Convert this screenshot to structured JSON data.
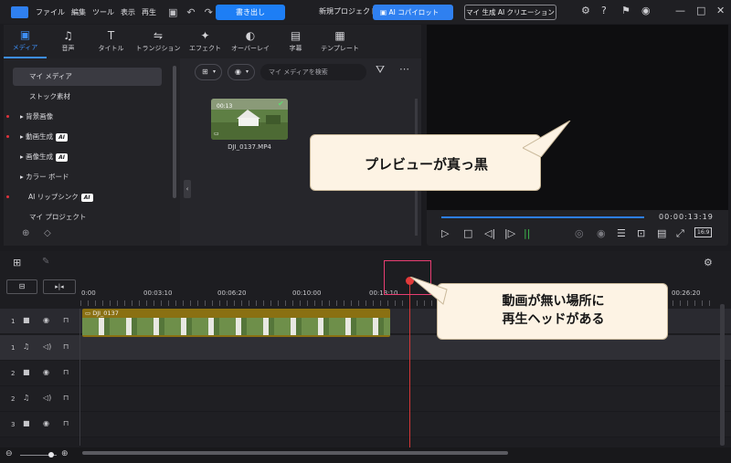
{
  "menu": [
    "ファイル",
    "編集",
    "ツール",
    "表示",
    "再生"
  ],
  "toolbar": {
    "export_label": "書き出し",
    "project_title": "新規プロジェクト (",
    "copilot_label": "AI コパイロット",
    "ai_creation_label": "マイ 生成 AI クリエーション"
  },
  "tabs": [
    {
      "label": "メディア",
      "icon": "media-icon",
      "glyph": "▣"
    },
    {
      "label": "音声",
      "icon": "music-note-icon",
      "glyph": "♫"
    },
    {
      "label": "タイトル",
      "icon": "text-icon",
      "glyph": "T"
    },
    {
      "label": "トランジション",
      "icon": "transition-icon",
      "glyph": "⇋"
    },
    {
      "label": "エフェクト",
      "icon": "effect-icon",
      "glyph": "✦"
    },
    {
      "label": "オーバーレイ",
      "icon": "overlay-icon",
      "glyph": "◐"
    },
    {
      "label": "字幕",
      "icon": "subtitle-icon",
      "glyph": "▤"
    },
    {
      "label": "テンプレート",
      "icon": "template-icon",
      "glyph": "▦"
    }
  ],
  "sidebar": {
    "items": [
      {
        "label": "マイ メディア",
        "dot": false,
        "arrow": false,
        "ai": false
      },
      {
        "label": "ストック素材",
        "dot": false,
        "arrow": false,
        "ai": false
      },
      {
        "label": "背景画像",
        "dot": true,
        "arrow": true,
        "ai": false
      },
      {
        "label": "動画生成",
        "dot": true,
        "arrow": true,
        "ai": true
      },
      {
        "label": "画像生成",
        "dot": false,
        "arrow": true,
        "ai": true
      },
      {
        "label": "カラー ボード",
        "dot": false,
        "arrow": true,
        "ai": false
      },
      {
        "label": "AI リップシンク",
        "dot": true,
        "arrow": false,
        "ai": true
      },
      {
        "label": "マイ プロジェクト",
        "dot": false,
        "arrow": false,
        "ai": false
      }
    ]
  },
  "ai_badge": "AI",
  "search": {
    "placeholder": "マイ メディアを検索"
  },
  "media": {
    "filename": "DJI_0137.MP4",
    "duration": "00:13"
  },
  "preview": {
    "timecode": "00:00:13:19",
    "quality": "16:9"
  },
  "callouts": {
    "preview": "プレビューが真っ黒",
    "playhead_line1": "動画が無い場所に",
    "playhead_line2": "再生ヘッドがある"
  },
  "ruler": [
    "0:00",
    "00:03:10",
    "00:06:20",
    "00:10:00",
    "00:13:10",
    "00:26:20"
  ],
  "clip": {
    "name": "DJI_0137"
  },
  "tracks": [
    {
      "num": "1",
      "type": "video"
    },
    {
      "num": "1",
      "type": "audio"
    },
    {
      "num": "2",
      "type": "video"
    },
    {
      "num": "2",
      "type": "audio"
    },
    {
      "num": "3",
      "type": "video"
    }
  ],
  "colors": {
    "accent": "#1d7ef5",
    "clip": "#8a7012",
    "playhead": "#d43737",
    "highlight": "#e83e72"
  }
}
